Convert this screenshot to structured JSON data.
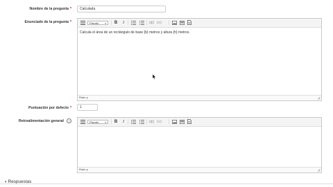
{
  "fields": {
    "question_name": {
      "label": "Nombre de la pregunta",
      "value": "Calculada"
    },
    "question_text": {
      "label": "Enunciado de la pregunta",
      "content": "Calcula el área de un rectángulo de base {b} metros y altura {h} metros.",
      "path_label": "Ruta: p"
    },
    "default_mark": {
      "label": "Puntuación por defecto",
      "value": "1"
    },
    "general_feedback": {
      "label": "Retroalimentación general",
      "content": "",
      "path_label": "Ruta: p"
    }
  },
  "required_marker": "*",
  "help_marker": "?",
  "toolbar": {
    "format_label": "Párrafo",
    "icons": [
      "show-more-icon",
      "bold-icon",
      "italic-icon",
      "unordered-list-icon",
      "ordered-list-icon",
      "link-icon",
      "unlink-icon",
      "image-icon",
      "media-icon",
      "document-icon"
    ]
  },
  "section": {
    "label": "Respuestas"
  }
}
